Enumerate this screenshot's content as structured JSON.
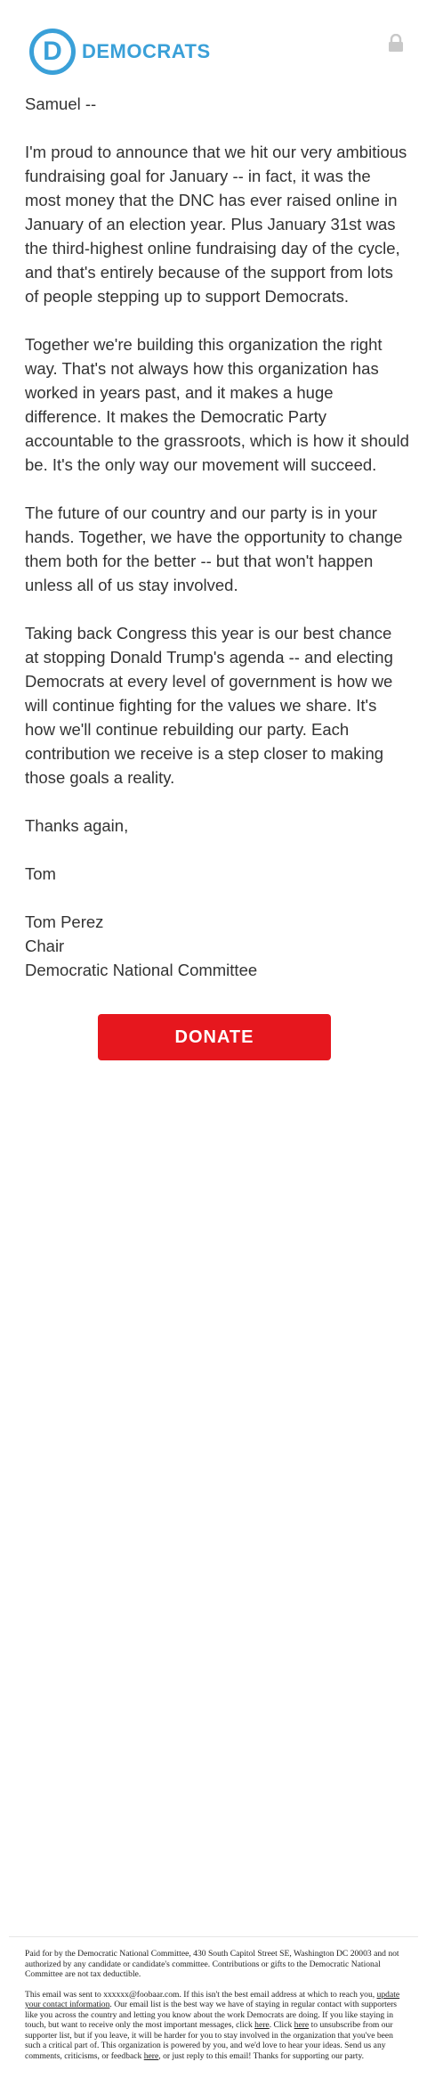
{
  "header": {
    "logo_letter": "D",
    "logo_text": "DEMOCRATS",
    "brand_color": "#3aa0d8",
    "lock_icon": "lock-icon"
  },
  "body": {
    "greeting": "Samuel --",
    "paragraphs": [
      "I'm proud to announce that we hit our very ambitious fundraising goal for January -- in fact, it was the most money that the DNC has ever raised online in January of an election year. Plus January 31st was the third-highest online fundraising day of the cycle, and that's entirely because of the support from lots of people stepping up to support Democrats.",
      "Together we're building this organization the right way. That's not always how this organization has worked in years past, and it makes a huge difference. It makes the Democratic Party accountable to the grassroots, which is how it should be. It's the only way our movement will succeed.",
      "The future of our country and our party is in your hands. Together, we have the opportunity to change them both for the better -- but that won't happen unless all of us stay involved.",
      "Taking back Congress this year is our best chance at stopping Donald Trump's agenda -- and electing Democrats at every level of government is how we will continue fighting for the values we share. It's how we'll continue rebuilding our party. Each contribution we receive is a step closer to making those goals a reality."
    ],
    "thanks": "Thanks again,",
    "first_name": "Tom",
    "signature": {
      "name": "Tom Perez",
      "title": "Chair",
      "org": "Democratic National Committee"
    }
  },
  "donate": {
    "label": "DONATE",
    "color": "#e6171e"
  },
  "footer": {
    "paid_for": "Paid for by the Democratic National Committee, 430 South Capitol Street SE, Washington DC 20003 and not authorized by any candidate or candidate's committee. Contributions or gifts to the Democratic National Committee are not tax deductible.",
    "sent_to_prefix": "This email was sent to xxxxxx@foobaar.com. If this isn't the best email address at which to reach you, ",
    "update_link": "update your contact information",
    "sent_to_mid": ". Our email list is the best way we have of staying in regular contact with supporters like you across the country and letting you know about the work Democrats are doing. If you like staying in touch, but want to receive only the most important messages, click ",
    "here_link_1": "here",
    "text_2": ". Click ",
    "here_link_2": "here",
    "text_3": " to unsubscribe from our supporter list, but if you leave, it will be harder for you to stay involved in the organization that you've been such a critical part of. This organization is powered by you, and we'd love to hear your ideas. Send us any comments, criticisms, or feedback ",
    "here_link_3": "here",
    "text_4": ", or just reply to this email! Thanks for supporting our party."
  }
}
